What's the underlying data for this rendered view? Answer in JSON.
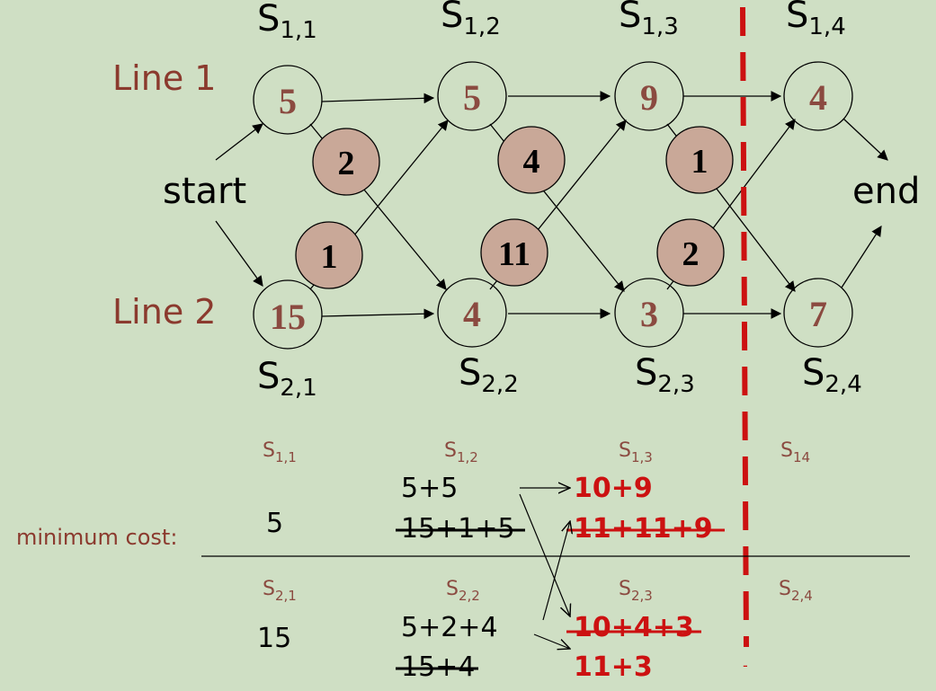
{
  "colors": {
    "background": "#cfdfc4",
    "line_label": "#8b3a2e",
    "station_value": "#8b4a40",
    "transfer_fill": "#c9a898",
    "red": "#cc1111",
    "black": "#000000"
  },
  "line_labels": {
    "line1": "Line 1",
    "line2": "Line 2"
  },
  "start_label": "start",
  "end_label": "end",
  "stations": {
    "line1": [
      {
        "id": "S",
        "sub": "1,1",
        "value": "5"
      },
      {
        "id": "S",
        "sub": "1,2",
        "value": "5"
      },
      {
        "id": "S",
        "sub": "1,3",
        "value": "9"
      },
      {
        "id": "S",
        "sub": "1,4",
        "value": "4"
      }
    ],
    "line2": [
      {
        "id": "S",
        "sub": "2,1",
        "value": "15"
      },
      {
        "id": "S",
        "sub": "2,2",
        "value": "4"
      },
      {
        "id": "S",
        "sub": "2,3",
        "value": "3"
      },
      {
        "id": "S",
        "sub": "2,4",
        "value": "7"
      }
    ]
  },
  "transfers": {
    "line1_to_line2": [
      "2",
      "4",
      "1"
    ],
    "line2_to_line1": [
      "1",
      "11",
      "2"
    ]
  },
  "table": {
    "row_label": "minimum cost:",
    "top_headers": [
      {
        "id": "S",
        "sub": "1,1"
      },
      {
        "id": "S",
        "sub": "1,2"
      },
      {
        "id": "S",
        "sub": "1,3"
      },
      {
        "id": "S",
        "sub": "14"
      }
    ],
    "bottom_headers": [
      {
        "id": "S",
        "sub": "2,1"
      },
      {
        "id": "S",
        "sub": "2,2"
      },
      {
        "id": "S",
        "sub": "2,3"
      },
      {
        "id": "S",
        "sub": "2,4"
      }
    ],
    "s11_value": "5",
    "s12_options": [
      "5+5",
      "15+1+5"
    ],
    "s13_options": [
      "10+9",
      "11+11+9"
    ],
    "s21_value": "15",
    "s22_options": [
      "5+2+4",
      "15+4"
    ],
    "s23_options": [
      "10+4+3",
      "11+3"
    ],
    "tail_mark": "-"
  }
}
